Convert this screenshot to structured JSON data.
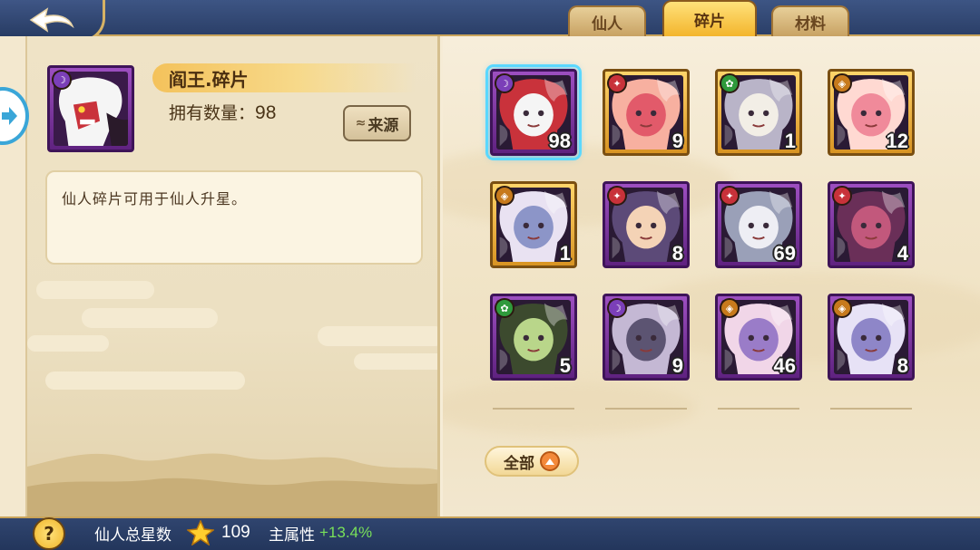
{
  "tabs": [
    {
      "label": "仙人",
      "active": false
    },
    {
      "label": "碎片",
      "active": true
    },
    {
      "label": "材料",
      "active": false
    }
  ],
  "detail": {
    "name": "阎王.碎片",
    "owned_label": "拥有数量：",
    "owned_count": "98",
    "source_button": "来源",
    "description": "仙人碎片可用于仙人升星。"
  },
  "fragments": [
    {
      "count": "98",
      "frame": "purple",
      "element": "dark",
      "element_color": "#7b3fb8",
      "palette": [
        "#f5f5f5",
        "#c9323b"
      ],
      "selected": true
    },
    {
      "count": "9",
      "frame": "gold",
      "element": "fire",
      "element_color": "#c8323a",
      "palette": [
        "#e25a6a",
        "#f7b0a0"
      ],
      "selected": false
    },
    {
      "count": "1",
      "frame": "gold",
      "element": "wood",
      "element_color": "#2f9a3c",
      "palette": [
        "#f2eee6",
        "#b9b4c8"
      ],
      "selected": false
    },
    {
      "count": "12",
      "frame": "gold",
      "element": "gold",
      "element_color": "#c77a1c",
      "palette": [
        "#f08a9a",
        "#ffd9d2"
      ],
      "selected": false
    },
    {
      "count": "1",
      "frame": "gold",
      "element": "gold",
      "element_color": "#c77a1c",
      "palette": [
        "#8c95c8",
        "#e9e2f2"
      ],
      "selected": false
    },
    {
      "count": "8",
      "frame": "purple",
      "element": "fire",
      "element_color": "#c8323a",
      "palette": [
        "#f4d3b6",
        "#5c4a78"
      ],
      "selected": false
    },
    {
      "count": "69",
      "frame": "purple",
      "element": "fire",
      "element_color": "#c8323a",
      "palette": [
        "#eeeef4",
        "#9aa0b8"
      ],
      "selected": false
    },
    {
      "count": "4",
      "frame": "purple",
      "element": "fire",
      "element_color": "#c8323a",
      "palette": [
        "#c2587c",
        "#6a2f58"
      ],
      "selected": false
    },
    {
      "count": "5",
      "frame": "purple",
      "element": "wood",
      "element_color": "#2f9a3c",
      "palette": [
        "#b9d68a",
        "#3c4a2e"
      ],
      "selected": false
    },
    {
      "count": "9",
      "frame": "purple",
      "element": "dark",
      "element_color": "#7b3fb8",
      "palette": [
        "#5c5472",
        "#c4b8d4"
      ],
      "selected": false
    },
    {
      "count": "46",
      "frame": "purple",
      "element": "gold",
      "element_color": "#c77a1c",
      "palette": [
        "#9a7cc8",
        "#f1d6e8"
      ],
      "selected": false
    },
    {
      "count": "8",
      "frame": "purple",
      "element": "gold",
      "element_color": "#c77a1c",
      "palette": [
        "#8e86c8",
        "#e7e2f6"
      ],
      "selected": false
    }
  ],
  "filter": {
    "label": "全部"
  },
  "footer": {
    "star_label": "仙人总星数",
    "star_count": "109",
    "attr_label": "主属性",
    "attr_value": "+13.4%"
  },
  "colors": {
    "navy": "#2c3e63",
    "gold_accent": "#f3b52d",
    "selected_glow": "#39b8ff",
    "attr_green": "#78e05a"
  }
}
